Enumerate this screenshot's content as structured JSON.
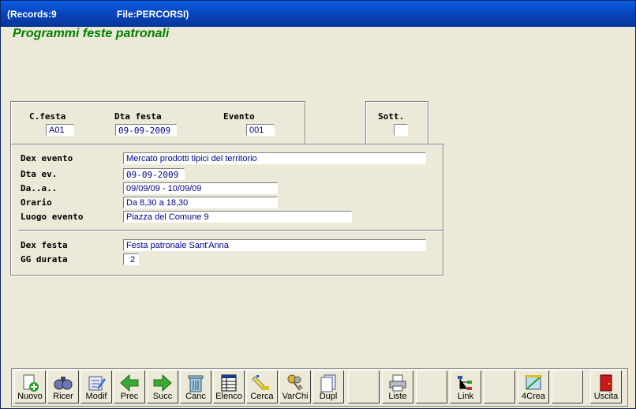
{
  "window": {
    "records_label": "(Records:9",
    "file_label": "File:PERCORSI)"
  },
  "heading": "Programmi feste patronali",
  "top_panel": {
    "cfesta_label": "C.festa",
    "cfesta_value": "A01",
    "dta_festa_label": "Dta festa",
    "dta_festa_value": "09-09-2009",
    "evento_label": "Evento",
    "evento_value": "001"
  },
  "sott_panel": {
    "label": "Sott.",
    "value": ""
  },
  "detail": {
    "dex_evento_label": "Dex evento",
    "dex_evento_value": "Mercato prodotti tipici del territorio",
    "dta_ev_label": "Dta ev.",
    "dta_ev_value": "09-09-2009",
    "da_a_label": "Da..a..",
    "da_a_value": "09/09/09 - 10/09/09",
    "orario_label": "Orario",
    "orario_value": "Da 8,30 a 18,30",
    "luogo_label": "Luogo evento",
    "luogo_value": "Piazza del Comune 9",
    "dex_festa_label": "Dex festa",
    "dex_festa_value": "Festa patronale Sant'Anna",
    "gg_durata_label": "GG durata",
    "gg_durata_value": "2"
  },
  "toolbar": {
    "nuovo": "Nuovo",
    "ricer": "Ricer",
    "modif": "Modif",
    "prec": "Prec",
    "succ": "Succ",
    "canc": "Canc",
    "elenco": "Elenco",
    "cerca": "Cerca",
    "varchi": "VarChi",
    "dupl": "Dupl",
    "liste": "Liste",
    "link": "Link",
    "crea": "4Crea",
    "uscita": "Uscita"
  },
  "colors": {
    "title_bar": "#0842b8",
    "heading": "#008000",
    "field_text": "#00008b"
  }
}
